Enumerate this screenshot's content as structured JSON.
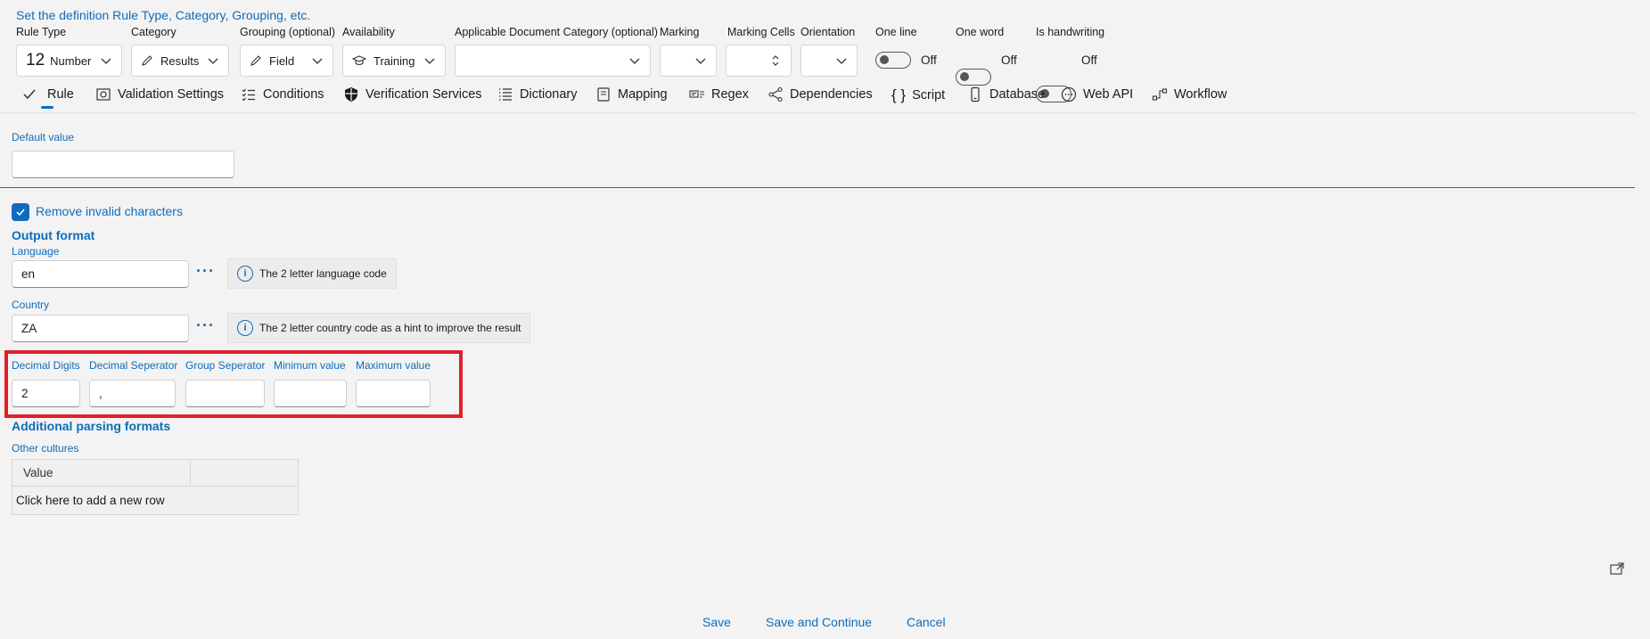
{
  "header": {
    "title": "Set the definition Rule Type, Category, Grouping, etc.",
    "fields": {
      "rule_type": {
        "label": "Rule Type",
        "icon_text": "12",
        "value": "Number"
      },
      "category": {
        "label": "Category",
        "value": "Results"
      },
      "grouping": {
        "label": "Grouping (optional)",
        "value": "Field"
      },
      "availability": {
        "label": "Availability",
        "value": "Training"
      },
      "doc_category": {
        "label": "Applicable Document Category (optional)",
        "value": ""
      },
      "marking": {
        "label": "Marking",
        "value": ""
      },
      "marking_cells": {
        "label": "Marking Cells",
        "value": ""
      },
      "orientation": {
        "label": "Orientation",
        "value": ""
      },
      "one_line": {
        "label": "One line",
        "state": "Off"
      },
      "one_word": {
        "label": "One word",
        "state": "Off"
      },
      "is_handwriting": {
        "label": "Is handwriting",
        "state": "Off"
      }
    }
  },
  "tabs": [
    {
      "label": "Rule",
      "icon": "check-icon"
    },
    {
      "label": "Validation Settings",
      "icon": "validation-icon"
    },
    {
      "label": "Conditions",
      "icon": "list-check-icon"
    },
    {
      "label": "Verification Services",
      "icon": "shield-icon"
    },
    {
      "label": "Dictionary",
      "icon": "list-icon"
    },
    {
      "label": "Mapping",
      "icon": "book-icon"
    },
    {
      "label": "Regex",
      "icon": "regex-icon"
    },
    {
      "label": "Dependencies",
      "icon": "share-icon"
    },
    {
      "label": "Script",
      "icon": "braces-icon"
    },
    {
      "label": "Database",
      "icon": "database-icon"
    },
    {
      "label": "Web API",
      "icon": "web-api-icon"
    },
    {
      "label": "Workflow",
      "icon": "workflow-icon"
    }
  ],
  "default_value": {
    "label": "Default value",
    "value": ""
  },
  "remove_invalid": {
    "label": "Remove invalid characters",
    "checked": true
  },
  "output_format": {
    "title": "Output format",
    "language": {
      "label": "Language",
      "value": "en",
      "hint": "The 2 letter language code"
    },
    "country": {
      "label": "Country",
      "value": "ZA",
      "hint": "The 2 letter country code as a hint to improve the result"
    },
    "decimal_digits": {
      "label": "Decimal Digits",
      "value": "2"
    },
    "decimal_separator": {
      "label": "Decimal Seperator",
      "value": ","
    },
    "group_separator": {
      "label": "Group Seperator",
      "value": ""
    },
    "minimum_value": {
      "label": "Minimum value",
      "value": ""
    },
    "maximum_value": {
      "label": "Maximum value",
      "value": ""
    }
  },
  "parsing": {
    "title": "Additional parsing formats",
    "other_cultures_label": "Other cultures",
    "table_header": "Value",
    "add_row": "Click here to add a new row"
  },
  "footer": {
    "save": "Save",
    "save_continue": "Save and Continue",
    "cancel": "Cancel"
  },
  "colors": {
    "accent": "#0f6cbd",
    "highlight": "#e0202a"
  }
}
